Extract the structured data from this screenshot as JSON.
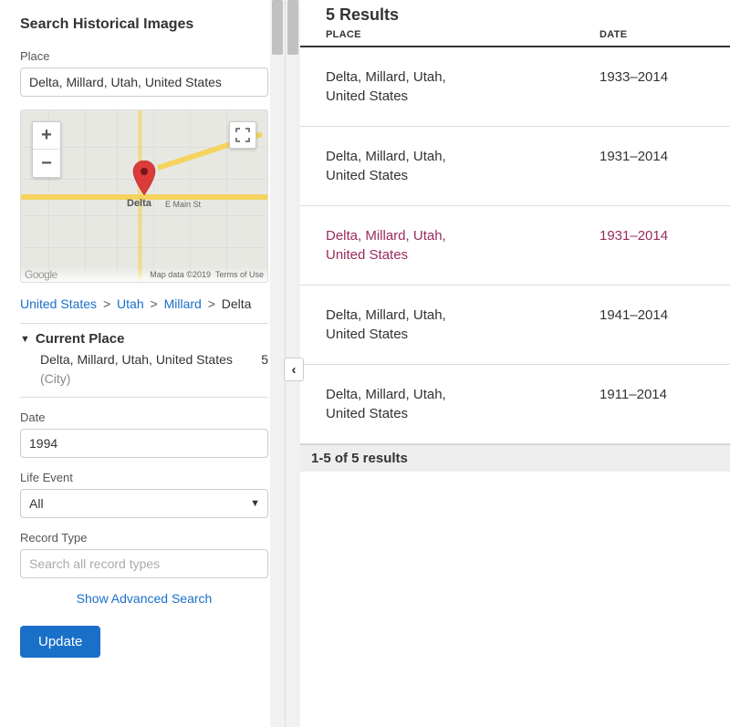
{
  "sidebar": {
    "title": "Search Historical Images",
    "place_label": "Place",
    "place_value": "Delta, Millard, Utah, United States",
    "breadcrumb": {
      "items": [
        "United States",
        "Utah",
        "Millard"
      ],
      "current": "Delta",
      "sep": ">"
    },
    "current_place": {
      "header": "Current Place",
      "name": "Delta, Millard, Utah, United States",
      "type": "(City)",
      "count": "5"
    },
    "date_label": "Date",
    "date_value": "1994",
    "life_event_label": "Life Event",
    "life_event_value": "All",
    "record_type_label": "Record Type",
    "record_type_placeholder": "Search all record types",
    "advanced_link": "Show Advanced Search",
    "update_button": "Update"
  },
  "map": {
    "place_label": "Delta",
    "street_label": "E Main St",
    "google": "Google",
    "data_attrib": "Map data ©2019",
    "terms": "Terms of Use",
    "zoom_in": "+",
    "zoom_out": "−"
  },
  "results": {
    "title": "5 Results",
    "col_place": "PLACE",
    "col_date": "DATE",
    "rows": [
      {
        "place": "Delta, Millard, Utah, United States",
        "date": "1933–2014",
        "active": false
      },
      {
        "place": "Delta, Millard, Utah, United States",
        "date": "1931–2014",
        "active": false
      },
      {
        "place": "Delta, Millard, Utah, United States",
        "date": "1931–2014",
        "active": true
      },
      {
        "place": "Delta, Millard, Utah, United States",
        "date": "1941–2014",
        "active": false
      },
      {
        "place": "Delta, Millard, Utah, United States",
        "date": "1911–2014",
        "active": false
      }
    ],
    "footer": "1-5 of 5 results"
  }
}
